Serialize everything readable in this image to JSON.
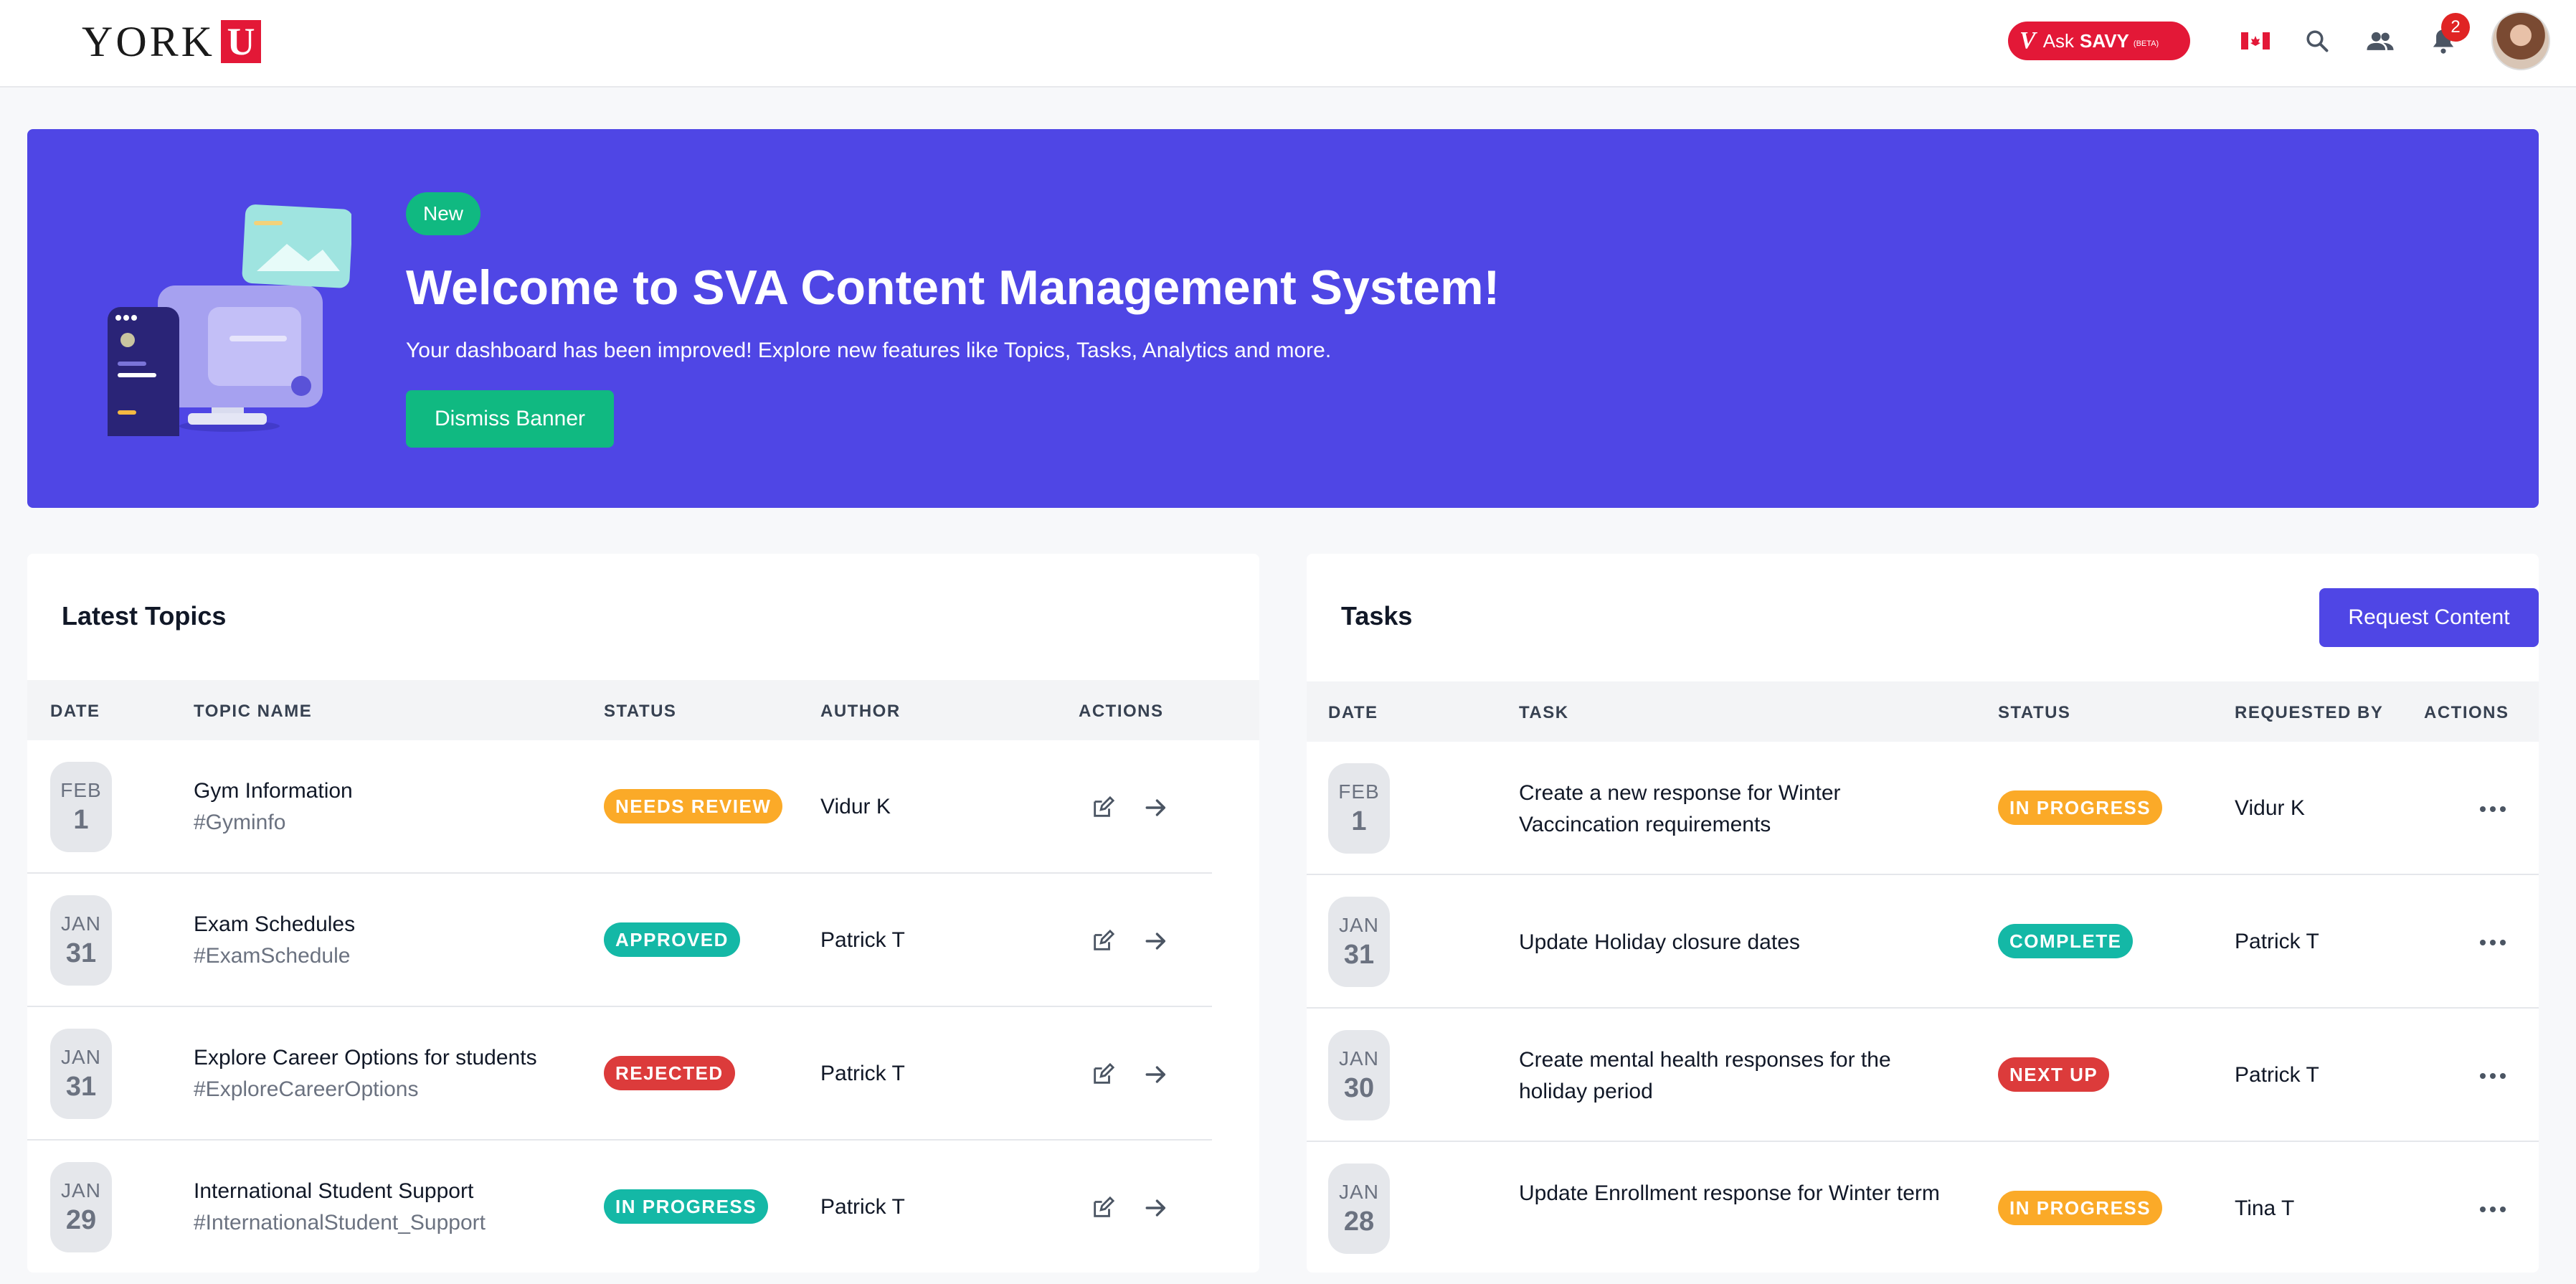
{
  "header": {
    "logo_text": "YORK",
    "logo_mark": "U",
    "asksavy": {
      "mark": "V",
      "ask": "Ask",
      "savy": "SAVY",
      "beta": "(BETA)"
    },
    "notification_count": "2",
    "icons": [
      "canada-flag-icon",
      "search-icon",
      "people-icon",
      "bell-icon",
      "avatar"
    ]
  },
  "banner": {
    "badge": "New",
    "title": "Welcome to SVA Content Management System!",
    "subtitle": "Your dashboard has been improved! Explore new features like Topics, Tasks, Analytics and more.",
    "button": "Dismiss Banner"
  },
  "topics": {
    "title": "Latest Topics",
    "headers": [
      "DATE",
      "TOPIC NAME",
      "STATUS",
      "AUTHOR",
      "ACTIONS"
    ],
    "rows": [
      {
        "month": "FEB",
        "day": "1",
        "name": "Gym Information",
        "tag": "#Gyminfo",
        "status": "NEEDS REVIEW",
        "author": "Vidur K"
      },
      {
        "month": "JAN",
        "day": "31",
        "name": "Exam Schedules",
        "tag": "#ExamSchedule",
        "status": "APPROVED",
        "author": "Patrick T"
      },
      {
        "month": "JAN",
        "day": "31",
        "name": "Explore Career Options for students",
        "tag": "#ExploreCareerOptions",
        "status": "REJECTED",
        "author": "Patrick T"
      },
      {
        "month": "JAN",
        "day": "29",
        "name": "International Student Support",
        "tag": "#InternationalStudent_Support",
        "status": "IN PROGRESS",
        "author": "Patrick T"
      }
    ]
  },
  "tasks": {
    "title": "Tasks",
    "button": "Request Content",
    "headers": [
      "DATE",
      "TASK",
      "STATUS",
      "REQUESTED BY",
      "ACTIONS"
    ],
    "rows": [
      {
        "month": "FEB",
        "day": "1",
        "task": "Create a new response for Winter Vaccincation requirements",
        "status": "IN PROGRESS",
        "requested_by": "Vidur K"
      },
      {
        "month": "JAN",
        "day": "31",
        "task": "Update Holiday closure dates",
        "status": "COMPLETE",
        "requested_by": "Patrick T"
      },
      {
        "month": "JAN",
        "day": "30",
        "task": "Create mental health responses for the holiday period",
        "status": "NEXT UP",
        "requested_by": "Patrick T"
      },
      {
        "month": "JAN",
        "day": "28",
        "task": "Update Enrollment response for Winter term",
        "status": "IN PROGRESS",
        "requested_by": "Tina T"
      }
    ]
  },
  "colors": {
    "brand_red": "#e31837",
    "banner_bg": "#4f46e5",
    "accent_green": "#10b981",
    "status": {
      "NEEDS REVIEW": "#fbaa28",
      "APPROVED": "#14b8a6",
      "REJECTED": "#dc3b3b",
      "IN PROGRESS": "#fbaa28",
      "COMPLETE": "#14b8a6",
      "NEXT UP": "#dc3b3b"
    },
    "topic_in_progress": "#14b8a6"
  }
}
